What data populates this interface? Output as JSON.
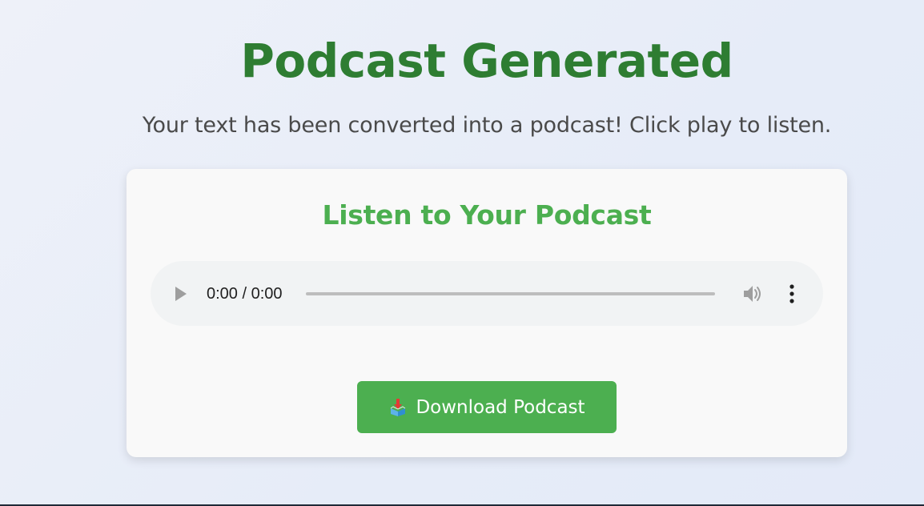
{
  "header": {
    "title": "Podcast Generated",
    "subtitle": "Your text has been converted into a podcast! Click play to listen."
  },
  "player_card": {
    "title": "Listen to Your Podcast",
    "audio": {
      "time_display": "0:00 / 0:00",
      "progress_fraction": 0,
      "play_icon": "play-icon",
      "volume_icon": "volume-icon",
      "more_icon": "more-vertical-icon"
    },
    "download_button": {
      "icon": "download-icon",
      "label": "Download Podcast"
    }
  },
  "colors": {
    "title": "#2e7d32",
    "accent": "#4caf50",
    "card_background": "#f9f9f9",
    "player_background": "#f1f3f4"
  }
}
